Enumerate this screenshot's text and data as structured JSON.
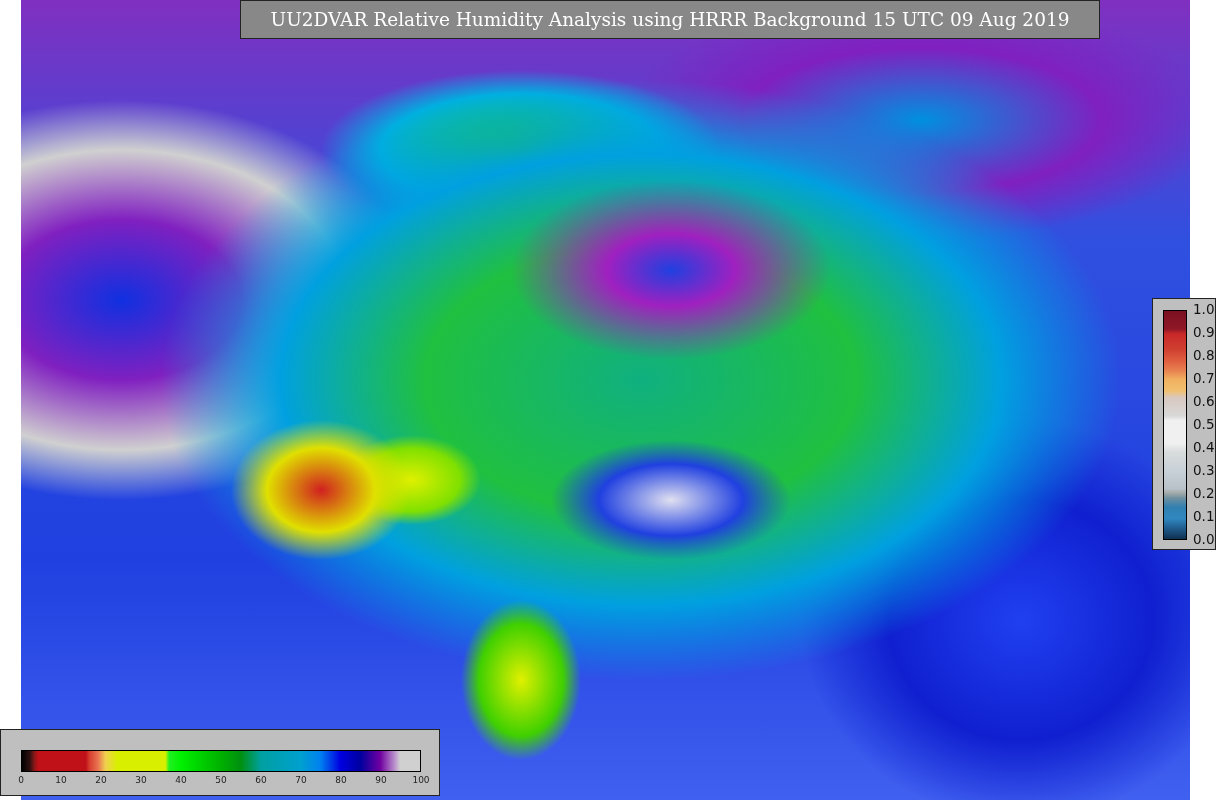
{
  "title": "UU2DVAR Relative Humidity Analysis using HRRR Background 15 UTC 09 Aug 2019",
  "ratio_colorbar": {
    "ticks": [
      "1.0",
      "0.9",
      "0.8",
      "0.7",
      "0.6",
      "0.5",
      "0.4",
      "0.3",
      "0.2",
      "0.1",
      "0.0"
    ]
  },
  "humidity_colorbar": {
    "ticks": [
      "0",
      "10",
      "20",
      "30",
      "40",
      "50",
      "60",
      "70",
      "80",
      "90",
      "100"
    ]
  }
}
